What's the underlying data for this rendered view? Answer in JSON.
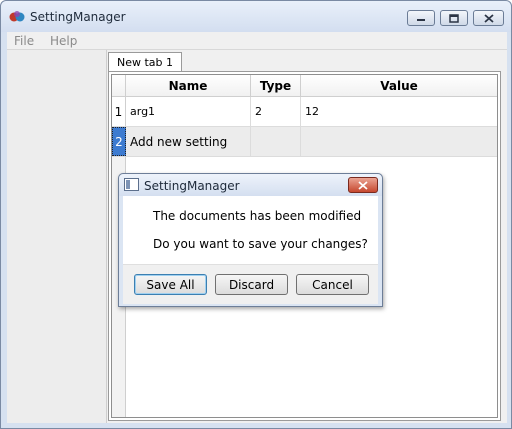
{
  "window": {
    "title": "SettingManager"
  },
  "menu": {
    "file": "File",
    "help": "Help"
  },
  "tabs": [
    {
      "label": "New tab 1"
    }
  ],
  "table": {
    "columns": [
      "Name",
      "Type",
      "Value"
    ],
    "rows": [
      {
        "num": "1",
        "name": "arg1",
        "type": "2",
        "value": "12"
      },
      {
        "num": "2",
        "name": "Add new setting",
        "type": "",
        "value": ""
      }
    ]
  },
  "dialog": {
    "title": "SettingManager",
    "message1": "The documents has been modified",
    "message2": "Do you want to save your changes?",
    "buttons": {
      "save_all": "Save All",
      "discard": "Discard",
      "cancel": "Cancel"
    }
  },
  "icons": {
    "app": "setting-manager-app-icon",
    "minimize": "minimize-icon",
    "maximize": "maximize-icon",
    "close": "close-icon",
    "dialog_app": "dialog-app-icon",
    "dialog_close": "dialog-close-icon"
  },
  "colors": {
    "selected_row_header": "#3d7bd0",
    "dialog_close": "#c6482f",
    "title_bar": "#d3def0"
  }
}
